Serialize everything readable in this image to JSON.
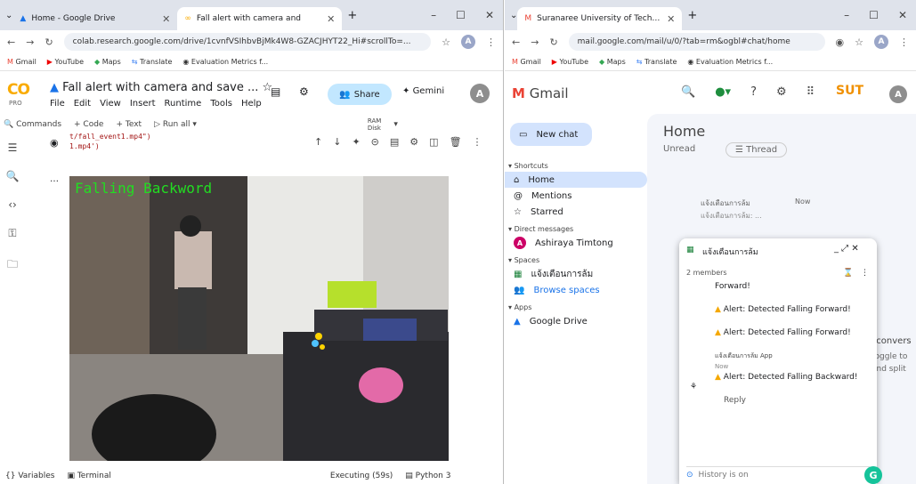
{
  "colab_window": {
    "tabs": [
      {
        "title": "Home - Google Drive"
      },
      {
        "title": "Fall alert with camera and"
      }
    ],
    "url": "colab.research.google.com/drive/1cvnfVSIhbvBjMk4W8-GZACJHYT22_Hi#scrollTo=...",
    "bookmarks": [
      "Gmail",
      "YouTube",
      "Maps",
      "Translate",
      "Evaluation Metrics f..."
    ],
    "logo": "CO",
    "plan": "PRO",
    "notebook_title": "Fall alert with camera and save ...",
    "menu": [
      "File",
      "Edit",
      "View",
      "Insert",
      "Runtime",
      "Tools",
      "Help"
    ],
    "share_label": "Share",
    "gemini_label": "Gemini",
    "avatar": "A",
    "commands_label": "Commands",
    "code_label": "+ Code",
    "text_label": "+ Text",
    "run_all_label": "Run all",
    "ram_label": "RAM",
    "disk_label": "Disk",
    "code_lines": [
      "t/fall_event1.mp4\")",
      "1.mp4')"
    ],
    "overlay_label": "Falling Backword",
    "variables_label": "Variables",
    "terminal_label": "Terminal",
    "status": "Executing (59s)",
    "runtime": "Python 3"
  },
  "gmail_window": {
    "tabs": [
      {
        "title": "Suranaree University of Techno"
      }
    ],
    "url": "mail.google.com/mail/u/0/?tab=rm&ogbl#chat/home",
    "bookmarks": [
      "Gmail",
      "YouTube",
      "Maps",
      "Translate",
      "Evaluation Metrics f..."
    ],
    "logo": "Gmail",
    "avatar": "A",
    "brand": "SUT",
    "new_chat_label": "New chat",
    "shortcuts_label": "Shortcuts",
    "nav": [
      "Home",
      "Mentions",
      "Starred"
    ],
    "dm_label": "Direct messages",
    "dm_name": "Ashiraya Timtong",
    "spaces_label": "Spaces",
    "space_name": "แจ้งเตือนการล้ม",
    "browse_spaces": "Browse spaces",
    "apps_label": "Apps",
    "app_name": "Google Drive",
    "home_title": "Home",
    "unread_label": "Unread",
    "thread_label": "Thread",
    "preview_name": "แจ้งเตือนการล้ม",
    "preview_sub": "แจ้งเตือนการล้ม: ...",
    "preview_time": "Now",
    "right_text_1": "o convers",
    "right_text_2": "toggle to",
    "right_text_3": "and split",
    "popup": {
      "title": "แจ้งเตือนการล้ม",
      "members": "2 members",
      "messages": [
        {
          "text": "Forward!"
        },
        {
          "text": "Alert: Detected Falling Forward!"
        },
        {
          "text": "Alert: Detected Falling Forward!"
        },
        {
          "text": "Alert: Detected Falling Backward!"
        }
      ],
      "sender": "แจ้งเตือนการล้ม App",
      "sender_time": "Now",
      "reply_label": "Reply",
      "history_label": "History is on"
    }
  }
}
